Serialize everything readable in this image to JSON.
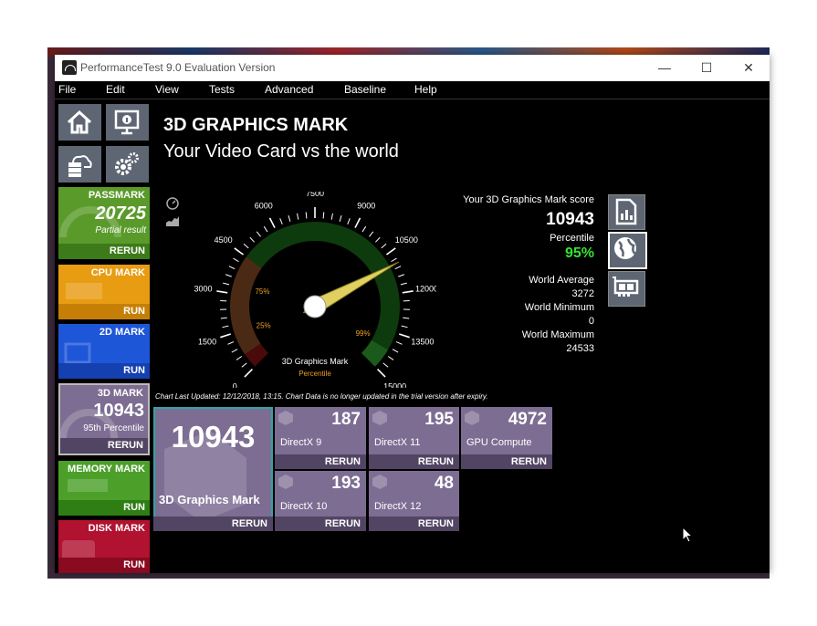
{
  "window": {
    "title": "PerformanceTest 9.0 Evaluation Version",
    "controls": {
      "minimize": "—",
      "maximize": "☐",
      "close": "✕"
    }
  },
  "menu": [
    "File",
    "Edit",
    "View",
    "Tests",
    "Advanced",
    "Baseline",
    "Help"
  ],
  "sidebar": {
    "icons": [
      "home-icon",
      "info-icon",
      "cloud-database-icon",
      "settings-gears-icon"
    ],
    "cards": [
      {
        "name": "passmark",
        "header": "PASSMARK",
        "value": "20725",
        "sub": "Partial result",
        "action": "RERUN",
        "color": "#5a9a2a",
        "foot_color": "#3c7a1a"
      },
      {
        "name": "cpu-mark",
        "header": "CPU MARK",
        "value": "",
        "sub": "",
        "action": "RUN",
        "color": "#e89c12",
        "foot_color": "#c67f06"
      },
      {
        "name": "2d-mark",
        "header": "2D MARK",
        "value": "",
        "sub": "",
        "action": "RUN",
        "color": "#1e56d8",
        "foot_color": "#1540b0"
      },
      {
        "name": "3d-mark",
        "header": "3D MARK",
        "value": "10943",
        "sub": "95th Percentile",
        "action": "RERUN",
        "color": "#7d6d92",
        "foot_color": "#514563"
      },
      {
        "name": "memory-mark",
        "header": "MEMORY MARK",
        "value": "",
        "sub": "",
        "action": "RUN",
        "color": "#4ca02a",
        "foot_color": "#2e7e14"
      },
      {
        "name": "disk-mark",
        "header": "DISK MARK",
        "value": "",
        "sub": "",
        "action": "RUN",
        "color": "#b01230",
        "foot_color": "#8a0a20"
      }
    ]
  },
  "header": {
    "title": "3D GRAPHICS MARK",
    "subtitle": "Your Video Card vs the world"
  },
  "gauge": {
    "ticks": [
      "0",
      "1500",
      "3000",
      "4500",
      "6000",
      "7500",
      "9000",
      "10500",
      "12000",
      "13500",
      "15000"
    ],
    "min": 0,
    "max": 15000,
    "needle_value": 10943,
    "percentiles": [
      "25%",
      "75%",
      "99%"
    ],
    "center_label": "3D Graphics Mark",
    "center_sub": "Percentile",
    "colors": {
      "dark_red": "#4a0a0a",
      "brown": "#4a2a14",
      "dark_green": "#0d3b0d",
      "green": "#1a5a1a",
      "needle": "#e0d060",
      "percentile_text": "#f0a020"
    }
  },
  "score": {
    "label": "Your 3D Graphics Mark score",
    "value": "10943",
    "percentile_label": "Percentile",
    "percentile_value": "95%",
    "percentile_color": "#32e432",
    "world_average_label": "World Average",
    "world_average": "3272",
    "world_minimum_label": "World Minimum",
    "world_minimum": "0",
    "world_maximum_label": "World Maximum",
    "world_maximum": "24533"
  },
  "right_buttons": [
    "document-chart-icon",
    "globe-icon",
    "graphics-card-icon"
  ],
  "note": "Chart Last Updated: 12/12/2018, 13:15. Chart Data is no longer updated in the trial version after expiry.",
  "results": {
    "main": {
      "value": "10943",
      "name": "3D Graphics Mark",
      "action": "RERUN"
    },
    "tiles": [
      {
        "value": "187",
        "name": "DirectX 9",
        "action": "RERUN"
      },
      {
        "value": "195",
        "name": "DirectX 11",
        "action": "RERUN"
      },
      {
        "value": "4972",
        "name": "GPU Compute",
        "action": "RERUN"
      },
      {
        "value": "193",
        "name": "DirectX 10",
        "action": "RERUN"
      },
      {
        "value": "48",
        "name": "DirectX 12",
        "action": "RERUN"
      }
    ]
  }
}
